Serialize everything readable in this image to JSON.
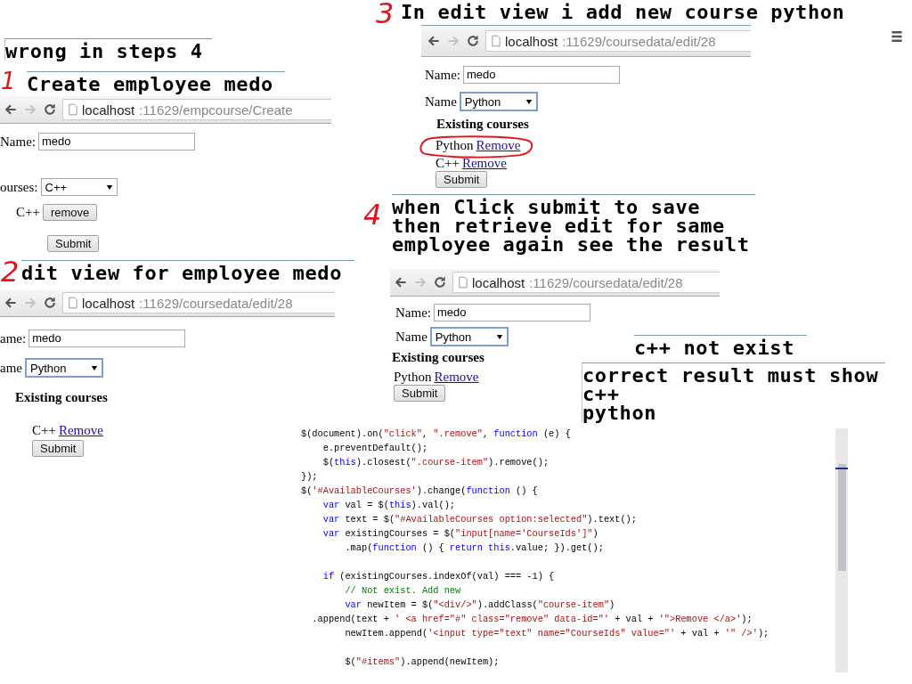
{
  "notes": [
    {
      "kind": "wrong",
      "lines": [
        "wrong in steps 4"
      ]
    },
    {
      "kind": "create",
      "lines": [
        "Create employee medo"
      ]
    },
    {
      "kind": "edit",
      "lines": [
        "dit view for employee medo"
      ]
    },
    {
      "kind": "add",
      "lines": [
        "In edit view i add new course python"
      ]
    },
    {
      "kind": "submit",
      "lines": [
        "when Click submit to save",
        "then retrieve edit for same",
        "employee again see the result"
      ]
    },
    {
      "kind": "missing",
      "lines": [
        "c++ not exist"
      ]
    },
    {
      "kind": "correct",
      "lines": [
        "correct result must show",
        "c++",
        "python"
      ]
    }
  ],
  "step_marks": [
    "1",
    "2",
    "3",
    "4"
  ],
  "panels": [
    {
      "address": {
        "host": "localhost",
        "path": ":11629/empcourse/Create"
      },
      "rows": [
        {
          "kind": "text-field",
          "label": "Name:",
          "value": "medo"
        },
        {
          "kind": "select",
          "label": "ourses:",
          "value": "C++",
          "focused": false
        },
        {
          "kind": "course-button",
          "course": "C++",
          "action": "remove"
        },
        {
          "kind": "submit",
          "label": "Submit"
        }
      ]
    },
    {
      "address": {
        "host": "localhost",
        "path": ":11629/coursedata/edit/28"
      },
      "rows": [
        {
          "kind": "text-field",
          "label": "ame:",
          "value": "medo"
        },
        {
          "kind": "select",
          "label": "ame",
          "value": "Python",
          "focused": true
        },
        {
          "kind": "heading",
          "label": "Existing courses"
        },
        {
          "kind": "course-link",
          "course": "C++",
          "action": "Remove",
          "circled": false
        },
        {
          "kind": "submit",
          "label": "Submit"
        }
      ]
    },
    {
      "address": {
        "host": "localhost",
        "path": ":11629/coursedata/edit/28"
      },
      "rows": [
        {
          "kind": "text-field",
          "label": "Name:",
          "value": "medo"
        },
        {
          "kind": "select",
          "label": "Name",
          "value": "Python",
          "focused": true
        },
        {
          "kind": "heading",
          "label": "Existing courses"
        },
        {
          "kind": "course-link",
          "course": "Python",
          "action": "Remove",
          "circled": true
        },
        {
          "kind": "course-link",
          "course": "C++",
          "action": "Remove",
          "circled": false
        },
        {
          "kind": "submit",
          "label": "Submit"
        }
      ]
    },
    {
      "address": {
        "host": "localhost",
        "path": ":11629/coursedata/edit/28"
      },
      "rows": [
        {
          "kind": "text-field",
          "label": "Name:",
          "value": "medo"
        },
        {
          "kind": "select",
          "label": "Name",
          "value": "Python",
          "focused": true
        },
        {
          "kind": "heading",
          "label": "Existing courses"
        },
        {
          "kind": "course-link",
          "course": "Python",
          "action": "Remove",
          "circled": false
        },
        {
          "kind": "submit",
          "label": "Submit"
        }
      ]
    }
  ],
  "code": {
    "lines": [
      {
        "kind": "code",
        "segments": [
          {
            "kind": "plain",
            "text": "$(document).on("
          },
          {
            "kind": "string",
            "text": "\"click\""
          },
          {
            "kind": "plain",
            "text": ", "
          },
          {
            "kind": "string",
            "text": "\".remove\""
          },
          {
            "kind": "plain",
            "text": ", "
          },
          {
            "kind": "keyword",
            "text": "function"
          },
          {
            "kind": "plain",
            "text": " (e) {"
          }
        ]
      },
      {
        "kind": "code",
        "segments": [
          {
            "kind": "plain",
            "text": "    e.preventDefault();"
          }
        ]
      },
      {
        "kind": "code",
        "segments": [
          {
            "kind": "plain",
            "text": "    $("
          },
          {
            "kind": "keyword",
            "text": "this"
          },
          {
            "kind": "plain",
            "text": ").closest("
          },
          {
            "kind": "string",
            "text": "\".course-item\""
          },
          {
            "kind": "plain",
            "text": ").remove();"
          }
        ]
      },
      {
        "kind": "code",
        "segments": [
          {
            "kind": "plain",
            "text": "});"
          }
        ]
      },
      {
        "kind": "code",
        "segments": [
          {
            "kind": "plain",
            "text": "$("
          },
          {
            "kind": "string",
            "text": "'#AvailableCourses'"
          },
          {
            "kind": "plain",
            "text": ").change("
          },
          {
            "kind": "keyword",
            "text": "function"
          },
          {
            "kind": "plain",
            "text": " () {"
          }
        ]
      },
      {
        "kind": "code",
        "segments": [
          {
            "kind": "keyword",
            "text": "    var"
          },
          {
            "kind": "plain",
            "text": " val = $("
          },
          {
            "kind": "keyword",
            "text": "this"
          },
          {
            "kind": "plain",
            "text": ").val();"
          }
        ]
      },
      {
        "kind": "code",
        "segments": [
          {
            "kind": "keyword",
            "text": "    var"
          },
          {
            "kind": "plain",
            "text": " text = $("
          },
          {
            "kind": "string",
            "text": "\"#AvailableCourses option:selected\""
          },
          {
            "kind": "plain",
            "text": ").text();"
          }
        ]
      },
      {
        "kind": "code",
        "segments": [
          {
            "kind": "keyword",
            "text": "    var"
          },
          {
            "kind": "plain",
            "text": " existingCourses = $("
          },
          {
            "kind": "string",
            "text": "\"input[name='CourseIds']\""
          },
          {
            "kind": "plain",
            "text": ")"
          }
        ]
      },
      {
        "kind": "code",
        "segments": [
          {
            "kind": "plain",
            "text": "        .map("
          },
          {
            "kind": "keyword",
            "text": "function"
          },
          {
            "kind": "plain",
            "text": " () { "
          },
          {
            "kind": "keyword",
            "text": "return this"
          },
          {
            "kind": "plain",
            "text": ".value; }).get();"
          }
        ]
      },
      {
        "kind": "blank"
      },
      {
        "kind": "code",
        "segments": [
          {
            "kind": "keyword",
            "text": "    if"
          },
          {
            "kind": "plain",
            "text": " (existingCourses.indexOf(val) === -1) {"
          }
        ]
      },
      {
        "kind": "code",
        "segments": [
          {
            "kind": "comment",
            "text": "        // Not exist. Add new"
          }
        ]
      },
      {
        "kind": "code",
        "segments": [
          {
            "kind": "keyword",
            "text": "        var"
          },
          {
            "kind": "plain",
            "text": " newItem = $("
          },
          {
            "kind": "string",
            "text": "\"<div/>\""
          },
          {
            "kind": "plain",
            "text": ").addClass("
          },
          {
            "kind": "string",
            "text": "\"course-item\""
          },
          {
            "kind": "plain",
            "text": ")"
          }
        ]
      },
      {
        "kind": "code",
        "segments": [
          {
            "kind": "plain",
            "text": "  .append(text + "
          },
          {
            "kind": "string",
            "text": "' <a href=\"#\" class=\"remove\" data-id=\"'"
          },
          {
            "kind": "plain",
            "text": " + val + "
          },
          {
            "kind": "string",
            "text": "'\">Remove </a>'"
          },
          {
            "kind": "plain",
            "text": ");"
          }
        ]
      },
      {
        "kind": "code",
        "segments": [
          {
            "kind": "plain",
            "text": "        newItem.append("
          },
          {
            "kind": "string",
            "text": "'<input type=\"text\" name=\"CourseIds\" value=\"'"
          },
          {
            "kind": "plain",
            "text": " + val + "
          },
          {
            "kind": "string",
            "text": "'\" />'"
          },
          {
            "kind": "plain",
            "text": ");"
          }
        ]
      },
      {
        "kind": "blank"
      },
      {
        "kind": "code",
        "segments": [
          {
            "kind": "plain",
            "text": "        $("
          },
          {
            "kind": "string",
            "text": "\"#items\""
          },
          {
            "kind": "plain",
            "text": ").append(newItem);"
          }
        ]
      }
    ]
  }
}
